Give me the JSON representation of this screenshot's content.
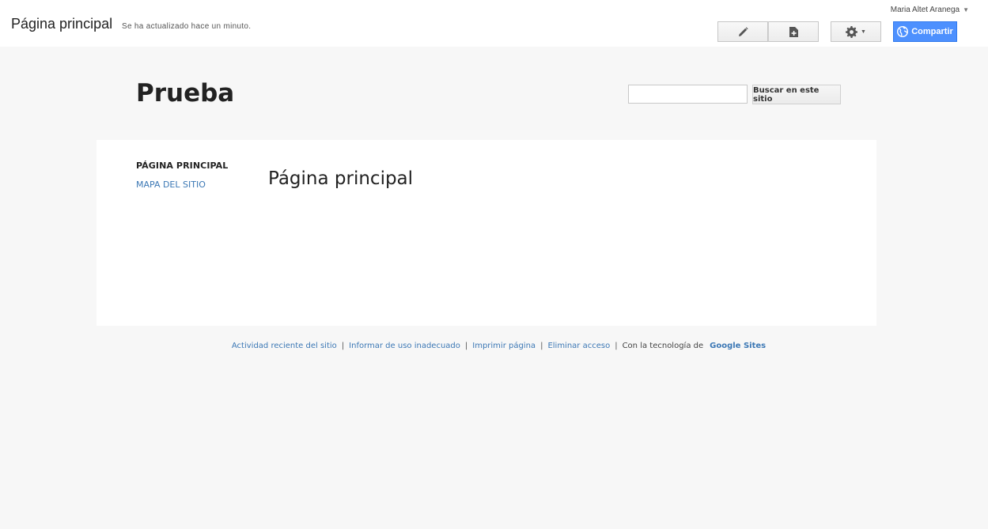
{
  "topbar": {
    "page_name": "Página principal",
    "updated": "Se ha actualizado hace un minuto.",
    "user_name": "Maria Altet Aranega",
    "edit_icon": "pencil-icon",
    "new_page_icon": "new-page-icon",
    "more_icon": "gear-icon",
    "share_label": "Compartir",
    "share_icon": "globe-icon",
    "share_color": "#4d90fe"
  },
  "site": {
    "title": "Prueba",
    "search_placeholder": "",
    "search_button": "Buscar en este sitio"
  },
  "nav": {
    "current": "PÁGINA PRINCIPAL",
    "sitemap": "MAPA DEL SITIO"
  },
  "main": {
    "heading": "Página principal"
  },
  "footer": {
    "recent_activity": "Actividad reciente del sitio",
    "report_abuse": "Informar de uso inadecuado",
    "print_page": "Imprimir página",
    "remove_access": "Eliminar acceso",
    "powered_by": "Con la tecnología de",
    "google_sites": "Google Sites",
    "separator": "|",
    "link_color": "#3c78b5"
  }
}
